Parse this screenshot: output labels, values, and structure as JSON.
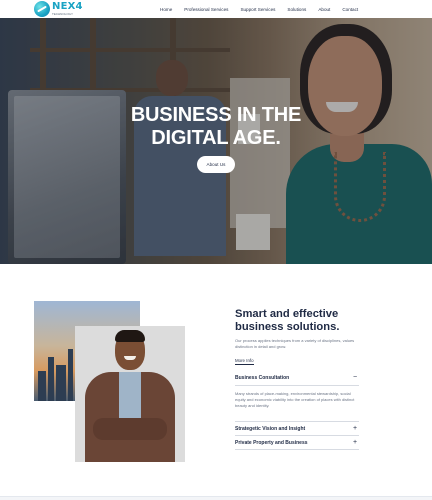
{
  "brand": {
    "name": "NEX4",
    "tagline": "TECHNOLOGY",
    "accent_color": "#1aa3c4"
  },
  "nav": {
    "items": [
      {
        "label": "Home"
      },
      {
        "label": "Professional Services"
      },
      {
        "label": "Support Services"
      },
      {
        "label": "Solutions"
      },
      {
        "label": "About"
      },
      {
        "label": "Contact"
      }
    ]
  },
  "hero": {
    "title_line1": "BUSINESS IN THE",
    "title_line2": "DIGITAL AGE.",
    "button_label": "About Us"
  },
  "about": {
    "title": "Smart and effective business solutions.",
    "description": "Our process applies techniques from a variety of disciplines, values distinction in detail and grow.",
    "more_link": "More Info"
  },
  "accordion": [
    {
      "title": "Business Consultation",
      "state_icon": "minus-icon",
      "sign": "−",
      "body": "Many strands of place-making, environmental stewardship, social equity and economic viability into the creation of places with distinct beauty and identity."
    },
    {
      "title": "Strategetic Vision and Insight",
      "state_icon": "plus-icon",
      "sign": "+"
    },
    {
      "title": "Private Property and Business",
      "state_icon": "plus-icon",
      "sign": "+"
    }
  ]
}
